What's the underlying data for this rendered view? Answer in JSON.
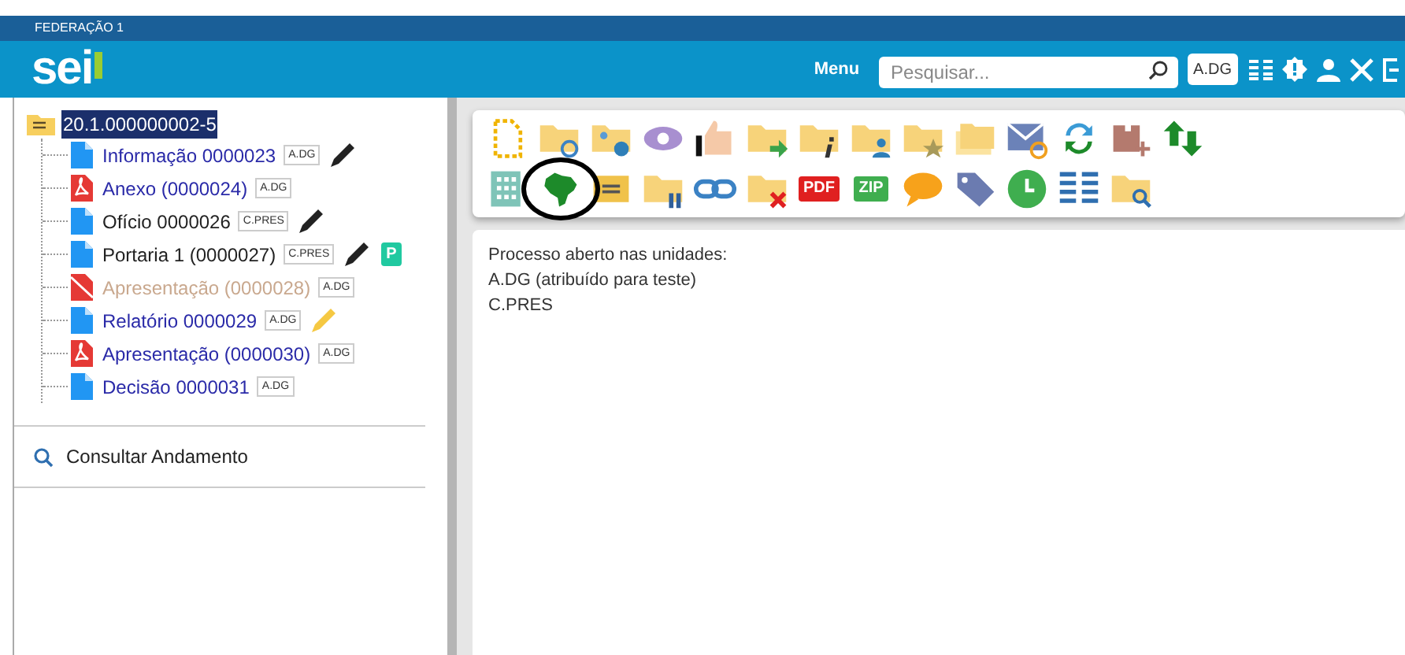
{
  "header": {
    "organization": "FEDERAÇÃO 1",
    "logo": "sei",
    "menu_label": "Menu",
    "search": {
      "placeholder": "Pesquisar..."
    },
    "unit_button": "A.DG"
  },
  "tree": {
    "root": {
      "label": "20.1.000000002-5",
      "selected": true
    },
    "items": [
      {
        "label": "Informação 0000023",
        "unit": "A.DG",
        "kind": "html",
        "visited": false,
        "signed": true,
        "signature_pending": false
      },
      {
        "label": "Anexo (0000024)",
        "unit": "A.DG",
        "kind": "pdf",
        "visited": false,
        "signed": false,
        "signature_pending": false
      },
      {
        "label": "Ofício 0000026",
        "unit": "C.PRES",
        "kind": "html",
        "visited": true,
        "signed": true,
        "signature_pending": false
      },
      {
        "label": "Portaria 1 (0000027)",
        "unit": "C.PRES",
        "kind": "html",
        "visited": true,
        "signed": true,
        "signature_pending": false,
        "badge": "P"
      },
      {
        "label": "Apresentação (0000028)",
        "unit": "A.DG",
        "kind": "cancelled",
        "signed": false,
        "signature_pending": false
      },
      {
        "label": "Relatório 0000029",
        "unit": "A.DG",
        "kind": "html",
        "visited": false,
        "signed": false,
        "signature_pending": true
      },
      {
        "label": "Apresentação (0000030)",
        "unit": "A.DG",
        "kind": "pdf",
        "visited": false,
        "signed": false,
        "signature_pending": false
      },
      {
        "label": "Decisão 0000031",
        "unit": "A.DG",
        "kind": "html",
        "visited": false,
        "signed": false,
        "signature_pending": false
      }
    ]
  },
  "consult_link": "Consultar Andamento",
  "content": {
    "lines": [
      "Processo aberto nas unidades:",
      "A.DG (atribuído para teste)",
      "C.PRES"
    ]
  },
  "toolbar": {
    "pdf_label": "PDF",
    "zip_label": "ZIP"
  }
}
